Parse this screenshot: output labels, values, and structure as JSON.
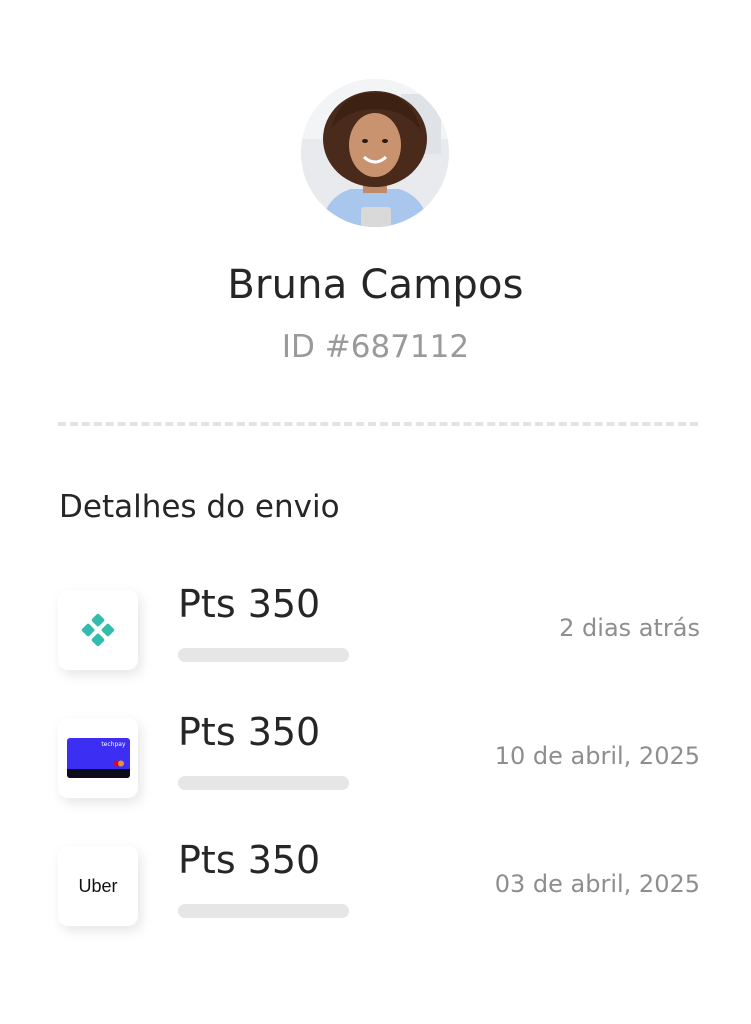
{
  "profile": {
    "name": "Bruna Campos",
    "id": "ID #687112"
  },
  "section": {
    "title": "Detalhes do envio"
  },
  "transactions": [
    {
      "icon": "pix-icon",
      "points": "Pts 350",
      "date": "2 dias atrás"
    },
    {
      "icon": "credit-card-icon",
      "card_brand": "techpay",
      "points": "Pts 350",
      "date": "10 de abril, 2025"
    },
    {
      "icon": "uber-logo-icon",
      "logo_text": "Uber",
      "points": "Pts 350",
      "date": "03 de abril, 2025"
    }
  ],
  "colors": {
    "text_primary": "#262626",
    "text_secondary": "#9a9a9a",
    "pix_teal": "#32bcad",
    "card_blue": "#3c2ef2",
    "bar_gray": "#e6e6e6"
  }
}
